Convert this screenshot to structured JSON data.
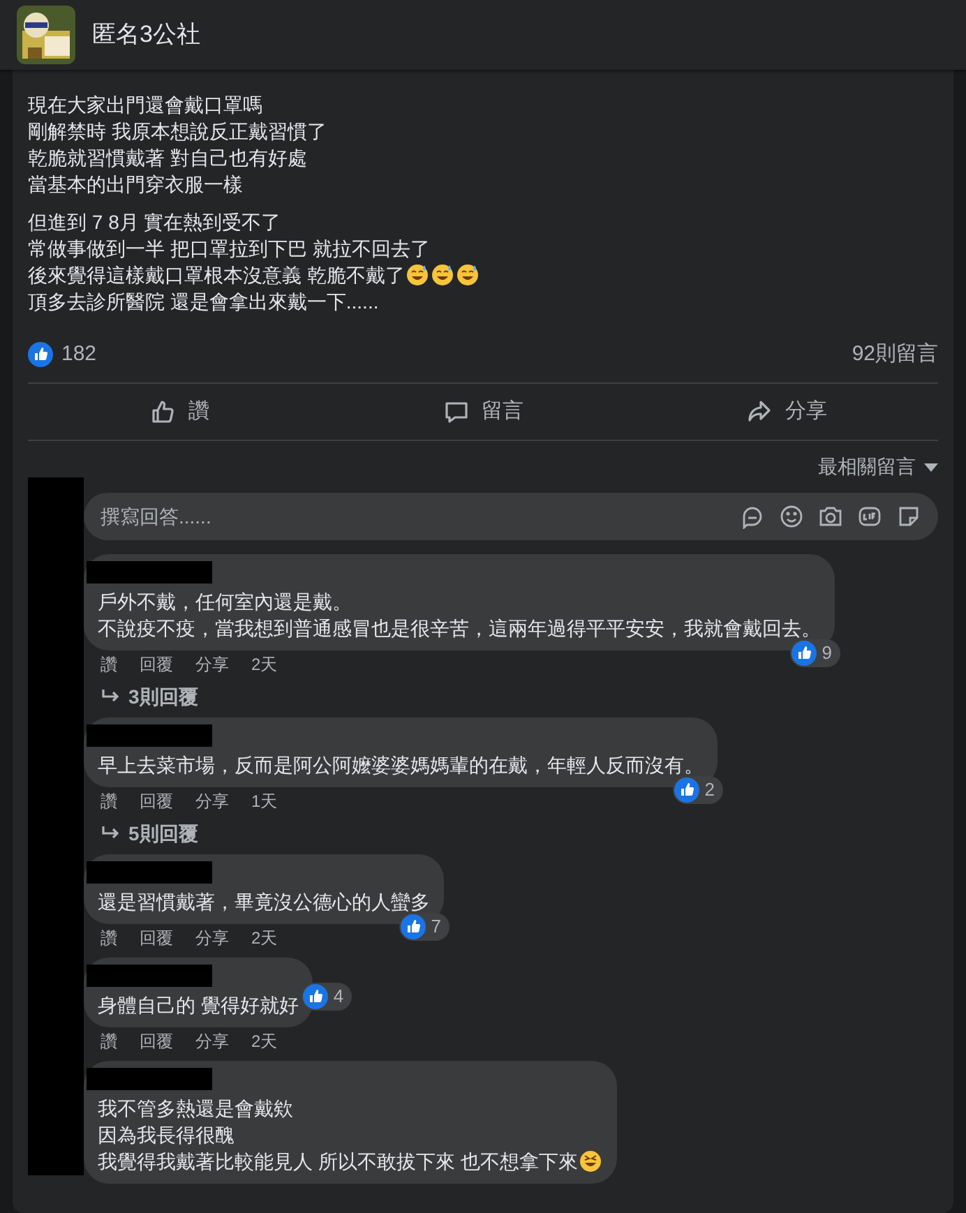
{
  "header": {
    "title": "匿名3公社"
  },
  "post": {
    "paragraphs": [
      {
        "lines": [
          {
            "text": "現在大家出門還會戴口罩嗎"
          },
          {
            "text": "剛解禁時 我原本想說反正戴習慣了"
          },
          {
            "text": "乾脆就習慣戴著 對自己也有好處"
          },
          {
            "text": "當基本的出門穿衣服一樣"
          }
        ]
      },
      {
        "lines": [
          {
            "text": "但進到 7 8月 實在熱到受不了"
          },
          {
            "text": "常做事做到一半 把口罩拉到下巴 就拉不回去了"
          },
          {
            "text": "後來覺得這樣戴口罩根本沒意義 乾脆不戴了",
            "emoji": [
              {
                "kind": "sweat-smile"
              },
              {
                "kind": "sweat-smile"
              },
              {
                "kind": "sweat-smile"
              }
            ]
          },
          {
            "text": "頂多去診所醫院 還是會拿出來戴一下......"
          }
        ]
      }
    ],
    "likes": "182",
    "comments_count": "92則留言"
  },
  "actions": [
    {
      "kind": "like",
      "label": "讚"
    },
    {
      "kind": "comment",
      "label": "留言"
    },
    {
      "kind": "share",
      "label": "分享"
    }
  ],
  "sort": {
    "label": "最相關留言"
  },
  "reply_box": {
    "placeholder": "撰寫回答......"
  },
  "comments": [
    {
      "lines": [
        {
          "text": "戶外不戴，任何室內還是戴。"
        },
        {
          "text": "不說疫不疫，當我想到普通感冒也是很辛苦，這兩年過得平平安安，我就會戴回去。"
        }
      ],
      "likes": "9",
      "meta": [
        "讚",
        "回覆",
        "分享"
      ],
      "time": "2天",
      "replies": "3則回覆"
    },
    {
      "lines": [
        {
          "text": "早上去菜市場，反而是阿公阿嬤婆婆媽媽輩的在戴，年輕人反而沒有。"
        }
      ],
      "likes": "2",
      "meta": [
        "讚",
        "回覆",
        "分享"
      ],
      "time": "1天",
      "replies": "5則回覆"
    },
    {
      "lines": [
        {
          "text": "還是習慣戴著，畢竟沒公德心的人蠻多"
        }
      ],
      "likes": "7",
      "meta": [
        "讚",
        "回覆",
        "分享"
      ],
      "time": "2天"
    },
    {
      "lines": [
        {
          "text": "身體自己的 覺得好就好"
        }
      ],
      "likes": "4",
      "inline_likes": true,
      "meta": [
        "讚",
        "回覆",
        "分享"
      ],
      "time": "2天"
    },
    {
      "lines": [
        {
          "text": "我不管多熱還是會戴欸"
        },
        {
          "text": "因為我長得很醜"
        },
        {
          "text": "我覺得我戴著比較能見人 所以不敢拔下來 也不想拿下來",
          "emoji": [
            {
              "kind": "laughing"
            }
          ]
        }
      ]
    }
  ]
}
